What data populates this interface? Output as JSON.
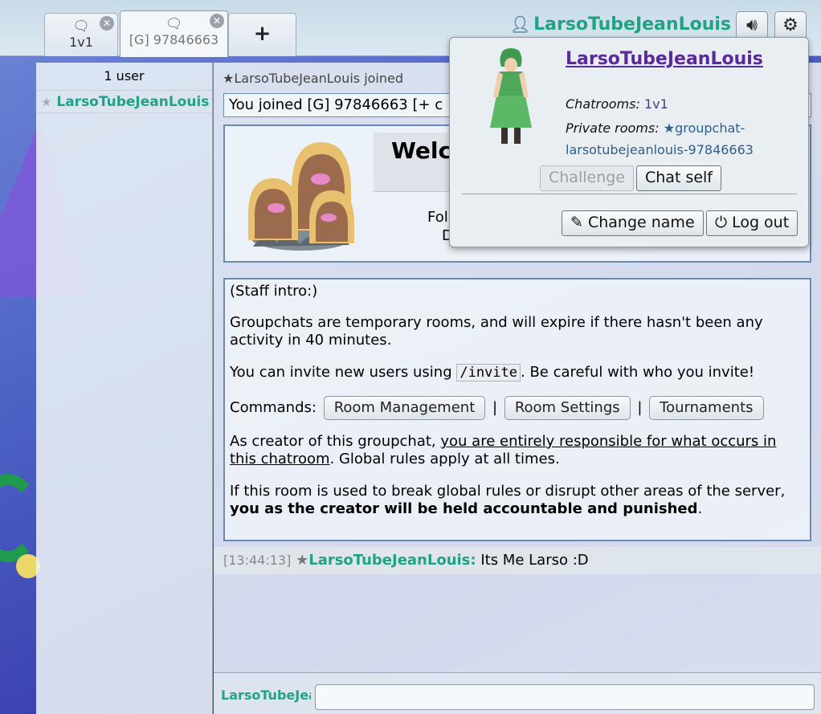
{
  "tabs": [
    {
      "icon": "chat-bubble-icon",
      "label": "1v1"
    },
    {
      "icon": "chat-bubble-icon",
      "label": "[G] 97846663"
    },
    {
      "icon": "plus-icon",
      "label": "+"
    }
  ],
  "header": {
    "username": "LarsoTubeJeanLouis",
    "sound_icon": "speaker-icon",
    "settings_icon": "gear-icon"
  },
  "userlist": {
    "count": "1 user",
    "users": [
      {
        "rank": "★",
        "name": "LarsoTubeJeanLouis"
      }
    ]
  },
  "chat": {
    "joined": "★LarsoTubeJeanLouis joined",
    "notice": "You joined [G] 97846663 [+ c",
    "welcome": {
      "title": "Welc",
      "fol": "Fol",
      "d": "D"
    },
    "intro": {
      "heading": "(Staff intro:)",
      "p1": "Groupchats are temporary rooms, and will expire if there hasn't been any activity in 40 minutes.",
      "p2_before": "You can invite new users using ",
      "p2_code": "/invite",
      "p2_after": ". Be careful with who you invite!",
      "commands_label": "Commands:",
      "cmd1": "Room Management",
      "cmd2": "Room Settings",
      "cmd3": "Tournaments",
      "sep": "|",
      "p4_before": "As creator of this groupchat, ",
      "p4_link": "you are entirely responsible for what occurs in this chatroom",
      "p4_after": ". Global rules apply at all times.",
      "p5_before": "If this room is used to break global rules or disrupt other areas of the server, ",
      "p5_bold": "you as the creator will be held accountable and punished",
      "p5_after": "."
    },
    "message": {
      "time": "[13:44:13]",
      "rank": "★",
      "name": "LarsoTubeJeanLouis:",
      "text": "Its Me Larso :D"
    }
  },
  "compose": {
    "name": "LarsoTubeJeanLouis",
    "placeholder": ""
  },
  "popup": {
    "name": "LarsoTubeJeanLouis",
    "chatrooms_label": "Chatrooms:",
    "chatrooms_value": "1v1",
    "private_label": "Private rooms:",
    "private_value": "★groupchat-larsotubejeanlouis-97846663",
    "challenge": "Challenge",
    "chat_self": "Chat self",
    "change_name": "Change name",
    "log_out": "Log out",
    "change_name_icon": "pencil-icon",
    "log_out_icon": "power-icon"
  }
}
